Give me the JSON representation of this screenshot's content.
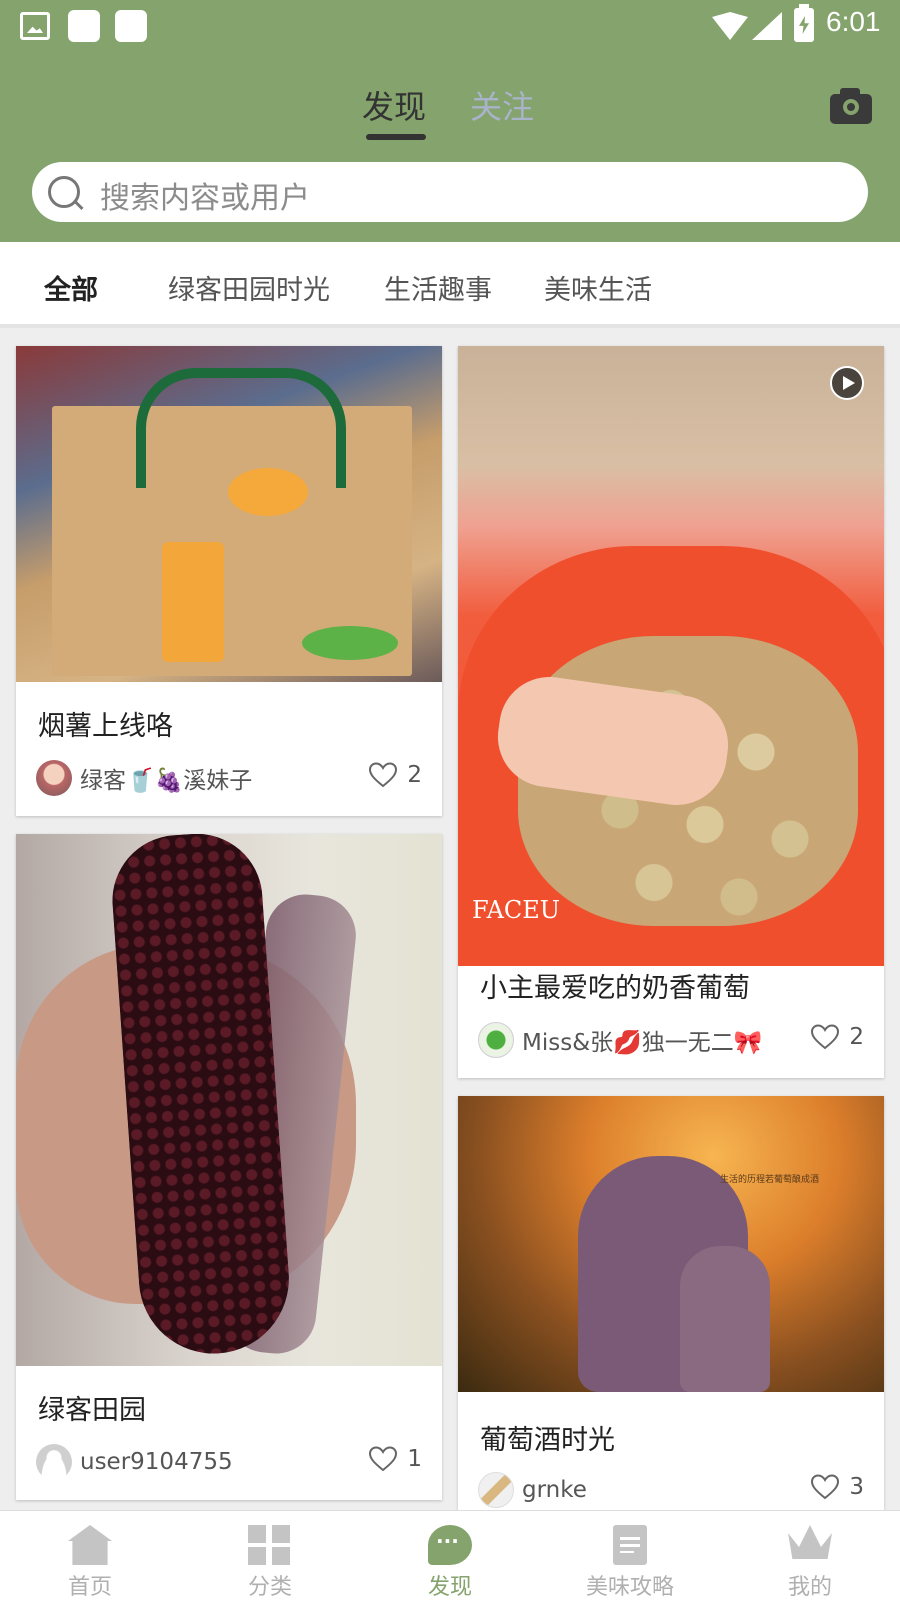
{
  "status_bar": {
    "time": "6:01"
  },
  "header": {
    "tabs": [
      {
        "label": "发现",
        "active": true
      },
      {
        "label": "关注",
        "active": false
      }
    ]
  },
  "search": {
    "placeholder": "搜索内容或用户"
  },
  "categories": [
    {
      "label": "全部",
      "active": true
    },
    {
      "label": "绿客田园时光",
      "active": false
    },
    {
      "label": "生活趣事",
      "active": false
    },
    {
      "label": "美味生活",
      "active": false
    }
  ],
  "posts": [
    {
      "title": "烟薯上线咯",
      "author": "绿客🥤🍇溪妹子",
      "likes": "2"
    },
    {
      "title": "小主最爱吃的奶香葡萄",
      "author": "Miss&张💋独一无二🎀",
      "likes": "2",
      "video": true,
      "watermark": "FACEU"
    },
    {
      "title": "绿客田园",
      "author": "user9104755",
      "likes": "1"
    },
    {
      "title": "葡萄酒时光",
      "author": "grnke",
      "likes": "3",
      "photo_caption": "生活的历程若葡萄酿成酒"
    }
  ],
  "bottom_nav": [
    {
      "label": "首页",
      "icon": "home-icon",
      "active": false
    },
    {
      "label": "分类",
      "icon": "grid-icon",
      "active": false
    },
    {
      "label": "发现",
      "icon": "chat-icon",
      "active": true
    },
    {
      "label": "美味攻略",
      "icon": "document-icon",
      "active": false
    },
    {
      "label": "我的",
      "icon": "crown-icon",
      "active": false
    }
  ],
  "colors": {
    "header_green": "#85a36c",
    "active_nav": "#85a36c",
    "inactive_tab": "#a9b3c9"
  }
}
